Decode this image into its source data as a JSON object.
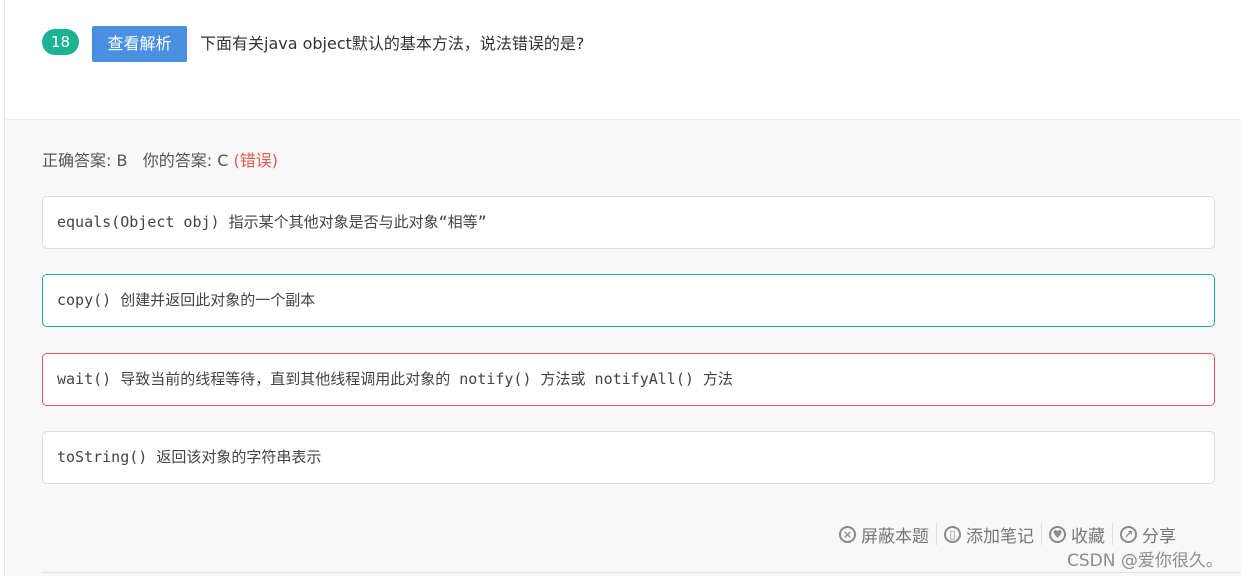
{
  "question": {
    "number": "18",
    "analysis_button": "查看解析",
    "text": "下面有关java object默认的基本方法，说法错误的是?"
  },
  "result": {
    "correct_label": "正确答案: B",
    "your_label": "你的答案: C",
    "status": "(错误)"
  },
  "options": [
    {
      "text": "equals(Object obj) 指示某个其他对象是否与此对象“相等”",
      "state": "normal"
    },
    {
      "text": "copy() 创建并返回此对象的一个副本",
      "state": "correct"
    },
    {
      "text": "wait() 导致当前的线程等待，直到其他线程调用此对象的 notify() 方法或 notifyAll() 方法",
      "state": "incorrect"
    },
    {
      "text": "toString() 返回该对象的字符串表示",
      "state": "normal"
    }
  ],
  "actions": {
    "block": {
      "label": "屏蔽本题",
      "icon": "close-circle-icon"
    },
    "note": {
      "label": "添加笔记",
      "icon": "book-icon"
    },
    "favorite": {
      "label": "收藏",
      "icon": "heart-icon"
    },
    "share": {
      "label": "分享",
      "icon": "share-icon"
    }
  },
  "watermark": "CSDN @爱你很久。",
  "colors": {
    "accent_green": "#1bb394",
    "button_blue": "#4a90e2",
    "error_red": "#e15a4b"
  }
}
